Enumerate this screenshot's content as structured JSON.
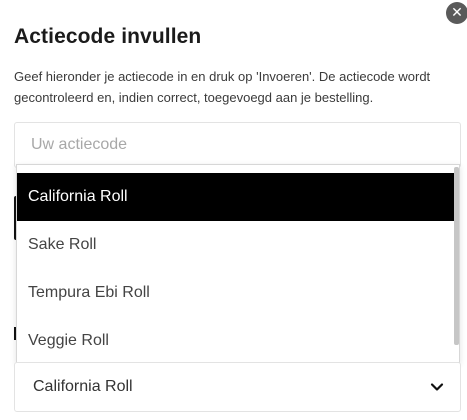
{
  "modal": {
    "title": "Actiecode invullen",
    "description": "Geef hieronder je actiecode in en druk op 'Invoeren'. De actiecode wordt gecontroleerd en, indien correct, toegevoegd aan je bestelling.",
    "close_icon": "close-icon"
  },
  "promo": {
    "placeholder": "Uw actiecode",
    "value": ""
  },
  "dropdown": {
    "options": [
      {
        "label": "California Roll",
        "selected": true
      },
      {
        "label": "Sake Roll",
        "selected": false
      },
      {
        "label": "Tempura Ebi Roll",
        "selected": false
      },
      {
        "label": "Veggie Roll",
        "selected": false
      }
    ],
    "selected_value": "California Roll",
    "chevron_icon": "chevron-down-icon"
  },
  "colors": {
    "selected_bg": "#000000",
    "selected_text": "#ffffff",
    "close_bg": "#5a5a5a"
  }
}
